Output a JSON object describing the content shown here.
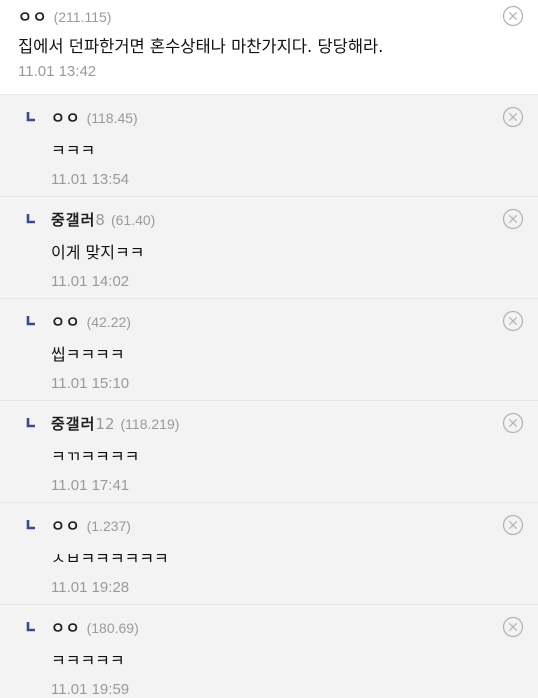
{
  "comments": {
    "main": {
      "author": "ㅇㅇ",
      "author_suffix": "",
      "ip": "(211.115)",
      "text": "집에서 던파한거면 혼수상태나 마찬가지다. 당당해라.",
      "time": "11.01 13:42",
      "delete_icon": "close-circle-icon"
    },
    "replies": [
      {
        "author": "ㅇㅇ",
        "author_suffix": "",
        "ip": "(118.45)",
        "text": "ㅋㅋㅋ",
        "time": "11.01 13:54"
      },
      {
        "author": "중갤러",
        "author_suffix": "8",
        "ip": "(61.40)",
        "text": "이게 맞지ㅋㅋ",
        "time": "11.01 14:02"
      },
      {
        "author": "ㅇㅇ",
        "author_suffix": "",
        "ip": "(42.22)",
        "text": "씹ㅋㅋㅋㅋ",
        "time": "11.01 15:10"
      },
      {
        "author": "중갤러",
        "author_suffix": "12",
        "ip": "(118.219)",
        "text": "ㅋㄲㅋㅋㅋㅋ",
        "time": "11.01 17:41"
      },
      {
        "author": "ㅇㅇ",
        "author_suffix": "",
        "ip": "(1.237)",
        "text": "ㅅㅂㅋㅋㅋㅋㅋㅋ",
        "time": "11.01 19:28"
      },
      {
        "author": "ㅇㅇ",
        "author_suffix": "",
        "ip": "(180.69)",
        "text": "ㅋㅋㅋㅋㅋ",
        "time": "11.01 19:59"
      }
    ]
  },
  "icons": {
    "reply_marker": "reply-arrow-icon",
    "delete": "close-circle-icon"
  },
  "colors": {
    "reply_background": "#f3f3f3",
    "divider": "#e6e6e6",
    "meta_text": "#9a9a9a",
    "reply_marker": "#3b4a8c"
  }
}
